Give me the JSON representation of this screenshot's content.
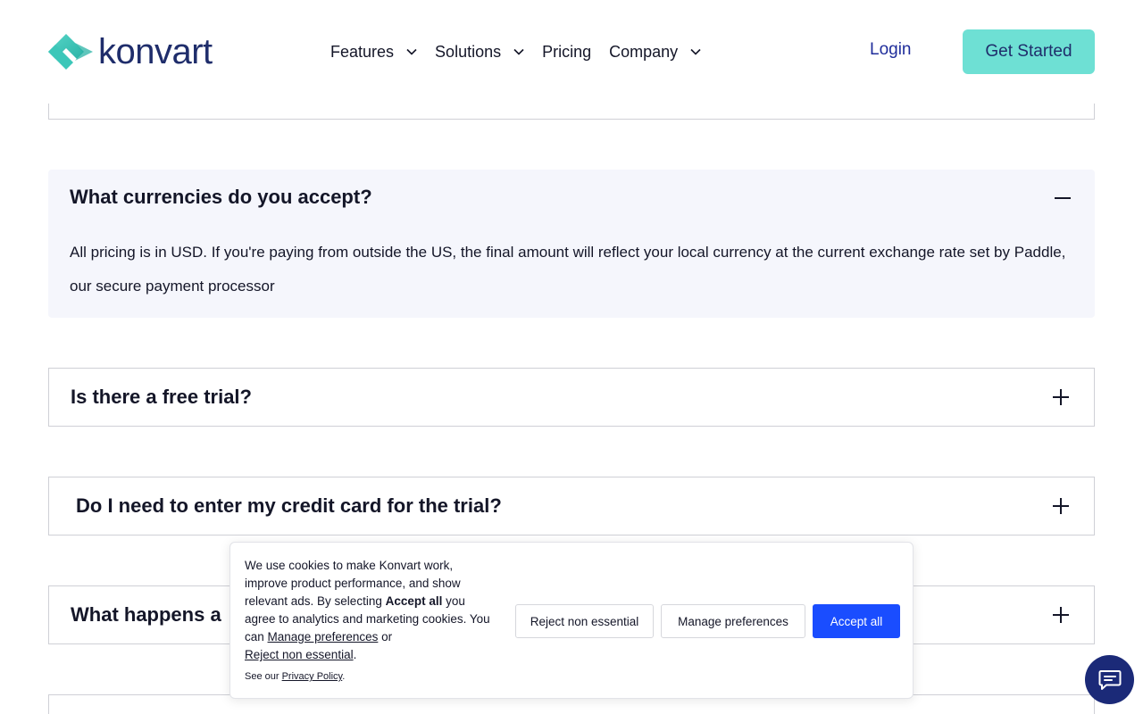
{
  "header": {
    "logo_text": "konvart",
    "nav": [
      {
        "label": "Features",
        "has_dropdown": true
      },
      {
        "label": "Solutions",
        "has_dropdown": true
      },
      {
        "label": "Pricing",
        "has_dropdown": false
      },
      {
        "label": "Company",
        "has_dropdown": true
      }
    ],
    "login_label": "Login",
    "get_started_label": "Get Started"
  },
  "faq": {
    "open_item": {
      "question": "What currencies do you accept?",
      "answer": "All pricing is in USD. If you're paying from outside the US, the final amount will reflect your local currency at the current exchange rate set by Paddle, our secure payment processor"
    },
    "items": [
      {
        "question": "Is there a free trial?"
      },
      {
        "question": "Do I need to enter my credit card for the trial?"
      },
      {
        "question": "What happens a"
      }
    ]
  },
  "cookie_banner": {
    "text_1": "We use cookies to make Konvart work, improve product performance, and show relevant ads. By selecting ",
    "accept_all_bold": "Accept all",
    "text_2": " you agree to analytics and marketing cookies. You can ",
    "manage_link": "Manage preferences",
    "text_3": " or ",
    "reject_link": "Reject non essential",
    "text_4": ".",
    "policy_prefix": "See our ",
    "policy_link": "Privacy Policy",
    "policy_suffix": ".",
    "reject_button": "Reject non essential",
    "manage_button": "Manage preferences",
    "accept_button": "Accept all"
  },
  "colors": {
    "brand_navy": "#1f2d6b",
    "brand_teal": "#6ee0d4",
    "accept_blue": "#1a4dff",
    "faq_open_bg": "#f5f6fc",
    "chat_bg": "#1b2a78"
  },
  "icons": {
    "logo": "konvart-diamond-logo",
    "nav_dropdown": "chevron-down-icon",
    "faq_collapse": "minus-icon",
    "faq_expand": "plus-icon",
    "chat": "chat-bubble-icon"
  }
}
